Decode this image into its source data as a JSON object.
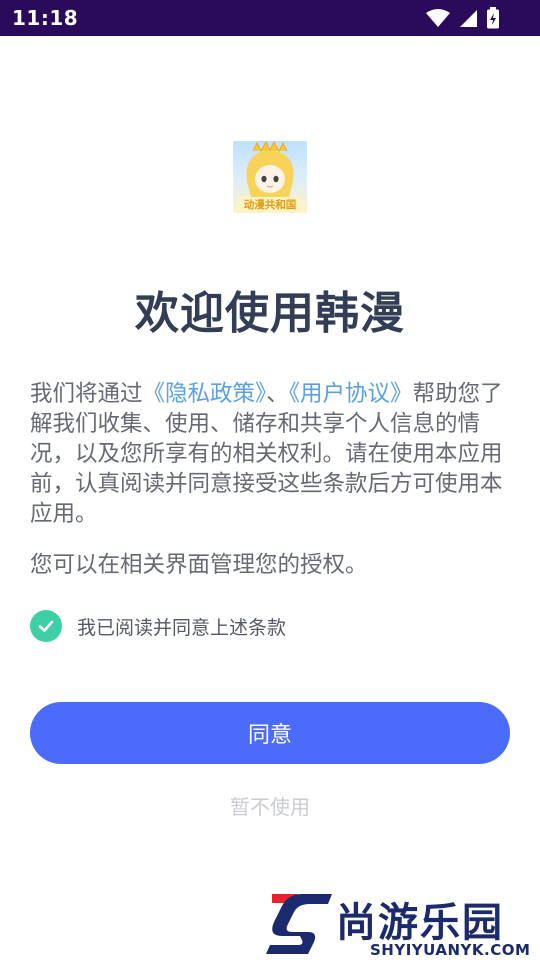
{
  "status_bar": {
    "time": "11:18"
  },
  "dialog": {
    "logo_text": "动漫共和国",
    "title": "欢迎使用韩漫",
    "intro_before": "我们将通过",
    "privacy_link": "《隐私政策》",
    "separator": "、",
    "agreement_link": "《用户协议》",
    "intro_after": "帮助您了解我们收集、使用、储存和共享个人信息的情况，以及您所享有的相关权利。请在使用本应用前，认真阅读并同意接受这些条款后方可使用本应用。",
    "manage_text": "您可以在相关界面管理您的授权。",
    "checkbox_label": "我已阅读并同意上述条款",
    "agree_button": "同意",
    "decline_button": "暂不使用"
  },
  "watermark": {
    "brand": "尚游乐园",
    "url": "SHYIYUANYK.COM"
  },
  "colors": {
    "status_bar": "#2a0a5a",
    "title": "#333d55",
    "body_text": "#666a73",
    "link": "#5aa0e8",
    "check": "#3ecfa6",
    "primary_button": "#4b6bfa",
    "secondary_text": "#c9ccd2"
  }
}
